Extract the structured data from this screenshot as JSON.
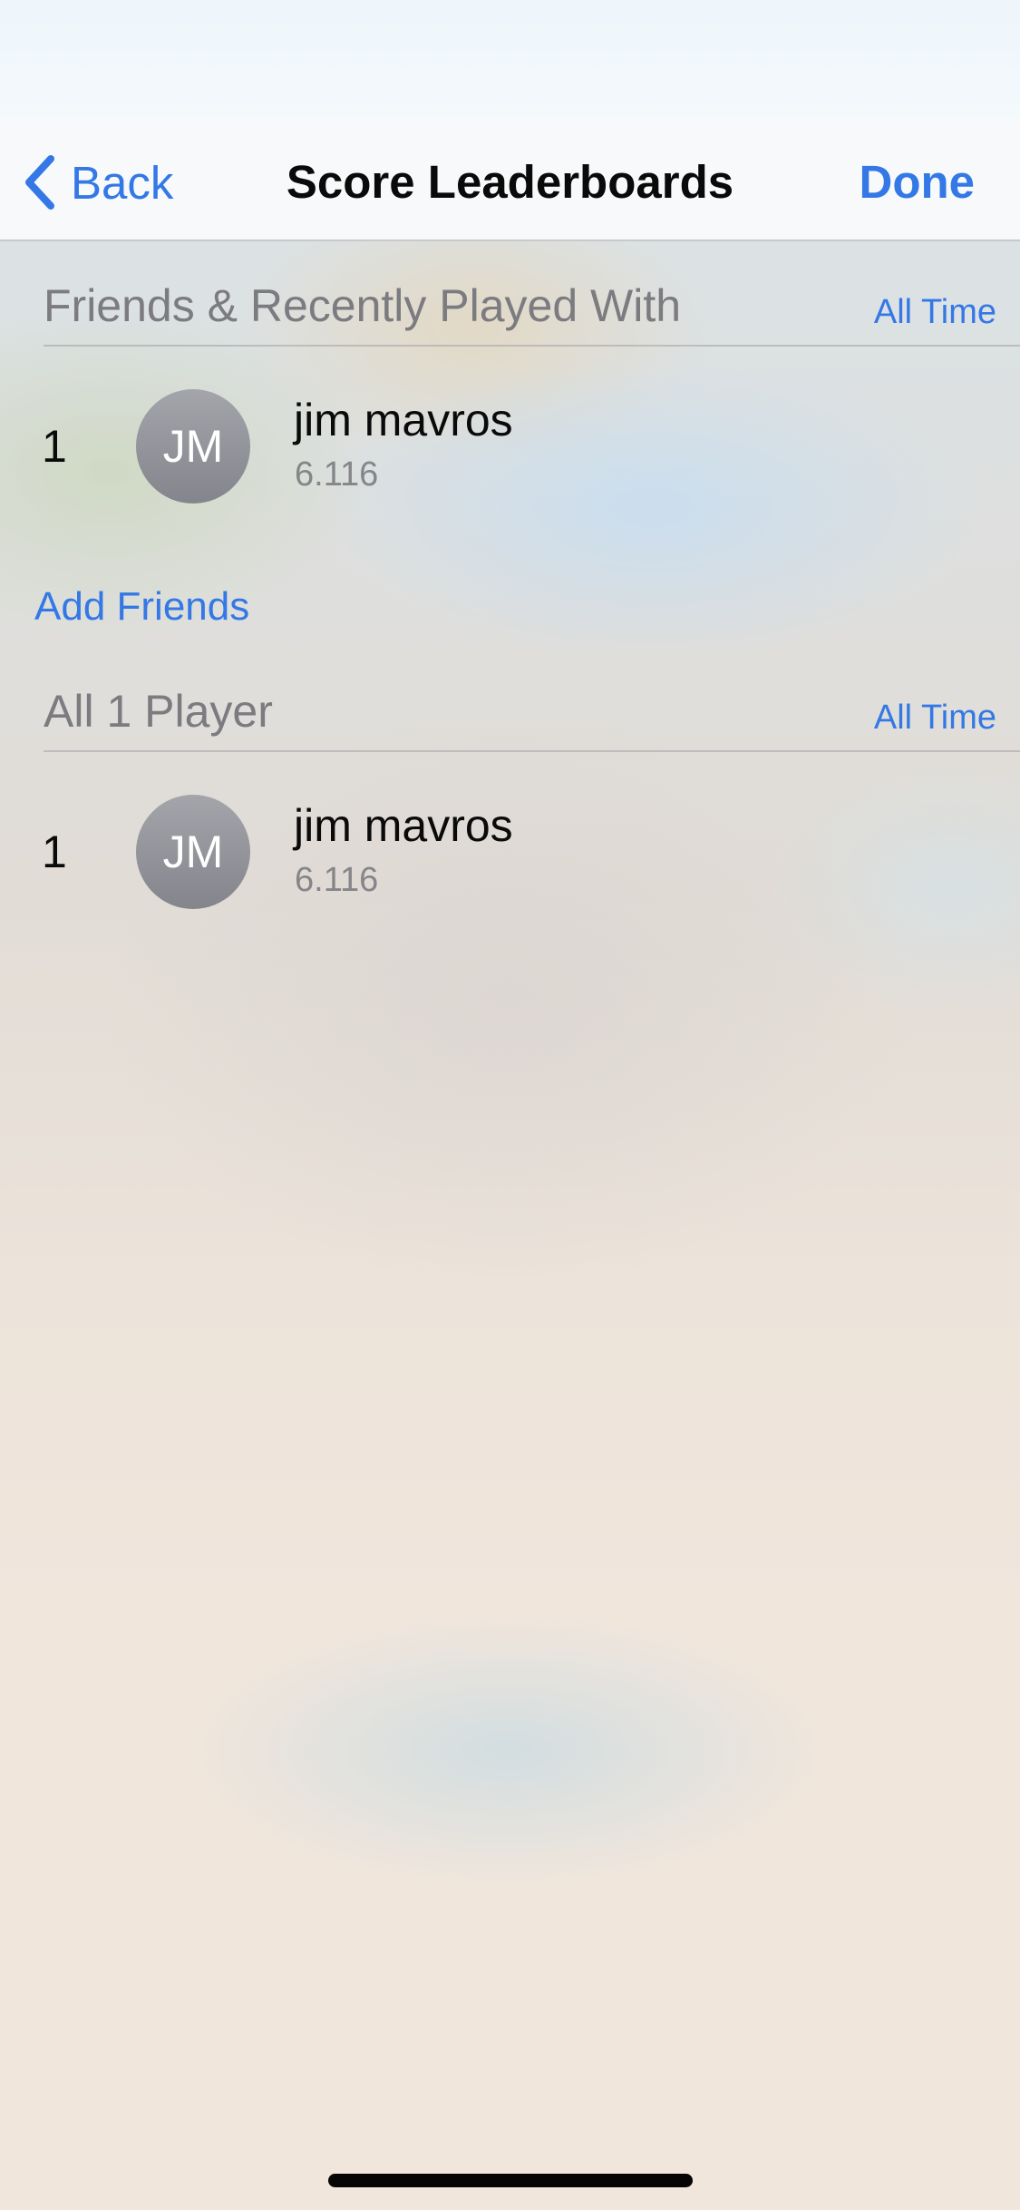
{
  "navbar": {
    "back_label": "Back",
    "title": "Score Leaderboards",
    "done_label": "Done"
  },
  "sections": [
    {
      "title": "Friends & Recently Played With",
      "filter_label": "All Time",
      "rows": [
        {
          "rank": "1",
          "initials": "JM",
          "name": "jim mavros",
          "score": "6.116"
        }
      ]
    },
    {
      "title": "All 1 Player",
      "filter_label": "All Time",
      "rows": [
        {
          "rank": "1",
          "initials": "JM",
          "name": "jim mavros",
          "score": "6.116"
        }
      ]
    }
  ],
  "add_friends_label": "Add Friends",
  "colors": {
    "accent": "#3478e6",
    "avatar": "#8e8f95",
    "secondary_text": "#7b7b80"
  },
  "icons": {
    "back": "chevron-left-icon"
  }
}
